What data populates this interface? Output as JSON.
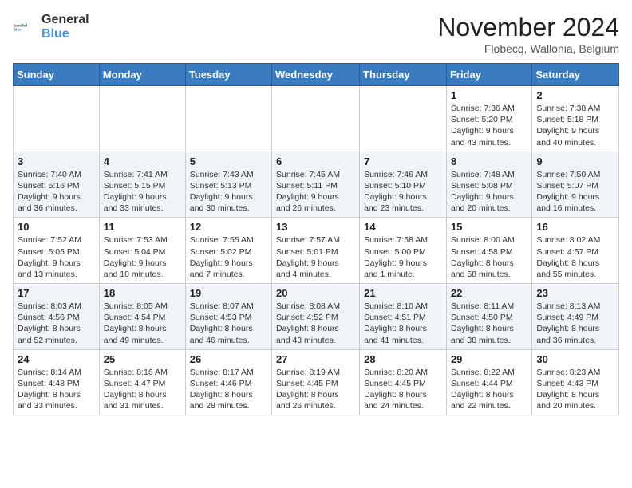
{
  "header": {
    "logo_line1": "General",
    "logo_line2": "Blue",
    "month_title": "November 2024",
    "location": "Flobecq, Wallonia, Belgium"
  },
  "columns": [
    "Sunday",
    "Monday",
    "Tuesday",
    "Wednesday",
    "Thursday",
    "Friday",
    "Saturday"
  ],
  "weeks": [
    [
      {
        "day": "",
        "info": ""
      },
      {
        "day": "",
        "info": ""
      },
      {
        "day": "",
        "info": ""
      },
      {
        "day": "",
        "info": ""
      },
      {
        "day": "",
        "info": ""
      },
      {
        "day": "1",
        "info": "Sunrise: 7:36 AM\nSunset: 5:20 PM\nDaylight: 9 hours and 43 minutes."
      },
      {
        "day": "2",
        "info": "Sunrise: 7:38 AM\nSunset: 5:18 PM\nDaylight: 9 hours and 40 minutes."
      }
    ],
    [
      {
        "day": "3",
        "info": "Sunrise: 7:40 AM\nSunset: 5:16 PM\nDaylight: 9 hours and 36 minutes."
      },
      {
        "day": "4",
        "info": "Sunrise: 7:41 AM\nSunset: 5:15 PM\nDaylight: 9 hours and 33 minutes."
      },
      {
        "day": "5",
        "info": "Sunrise: 7:43 AM\nSunset: 5:13 PM\nDaylight: 9 hours and 30 minutes."
      },
      {
        "day": "6",
        "info": "Sunrise: 7:45 AM\nSunset: 5:11 PM\nDaylight: 9 hours and 26 minutes."
      },
      {
        "day": "7",
        "info": "Sunrise: 7:46 AM\nSunset: 5:10 PM\nDaylight: 9 hours and 23 minutes."
      },
      {
        "day": "8",
        "info": "Sunrise: 7:48 AM\nSunset: 5:08 PM\nDaylight: 9 hours and 20 minutes."
      },
      {
        "day": "9",
        "info": "Sunrise: 7:50 AM\nSunset: 5:07 PM\nDaylight: 9 hours and 16 minutes."
      }
    ],
    [
      {
        "day": "10",
        "info": "Sunrise: 7:52 AM\nSunset: 5:05 PM\nDaylight: 9 hours and 13 minutes."
      },
      {
        "day": "11",
        "info": "Sunrise: 7:53 AM\nSunset: 5:04 PM\nDaylight: 9 hours and 10 minutes."
      },
      {
        "day": "12",
        "info": "Sunrise: 7:55 AM\nSunset: 5:02 PM\nDaylight: 9 hours and 7 minutes."
      },
      {
        "day": "13",
        "info": "Sunrise: 7:57 AM\nSunset: 5:01 PM\nDaylight: 9 hours and 4 minutes."
      },
      {
        "day": "14",
        "info": "Sunrise: 7:58 AM\nSunset: 5:00 PM\nDaylight: 9 hours and 1 minute."
      },
      {
        "day": "15",
        "info": "Sunrise: 8:00 AM\nSunset: 4:58 PM\nDaylight: 8 hours and 58 minutes."
      },
      {
        "day": "16",
        "info": "Sunrise: 8:02 AM\nSunset: 4:57 PM\nDaylight: 8 hours and 55 minutes."
      }
    ],
    [
      {
        "day": "17",
        "info": "Sunrise: 8:03 AM\nSunset: 4:56 PM\nDaylight: 8 hours and 52 minutes."
      },
      {
        "day": "18",
        "info": "Sunrise: 8:05 AM\nSunset: 4:54 PM\nDaylight: 8 hours and 49 minutes."
      },
      {
        "day": "19",
        "info": "Sunrise: 8:07 AM\nSunset: 4:53 PM\nDaylight: 8 hours and 46 minutes."
      },
      {
        "day": "20",
        "info": "Sunrise: 8:08 AM\nSunset: 4:52 PM\nDaylight: 8 hours and 43 minutes."
      },
      {
        "day": "21",
        "info": "Sunrise: 8:10 AM\nSunset: 4:51 PM\nDaylight: 8 hours and 41 minutes."
      },
      {
        "day": "22",
        "info": "Sunrise: 8:11 AM\nSunset: 4:50 PM\nDaylight: 8 hours and 38 minutes."
      },
      {
        "day": "23",
        "info": "Sunrise: 8:13 AM\nSunset: 4:49 PM\nDaylight: 8 hours and 36 minutes."
      }
    ],
    [
      {
        "day": "24",
        "info": "Sunrise: 8:14 AM\nSunset: 4:48 PM\nDaylight: 8 hours and 33 minutes."
      },
      {
        "day": "25",
        "info": "Sunrise: 8:16 AM\nSunset: 4:47 PM\nDaylight: 8 hours and 31 minutes."
      },
      {
        "day": "26",
        "info": "Sunrise: 8:17 AM\nSunset: 4:46 PM\nDaylight: 8 hours and 28 minutes."
      },
      {
        "day": "27",
        "info": "Sunrise: 8:19 AM\nSunset: 4:45 PM\nDaylight: 8 hours and 26 minutes."
      },
      {
        "day": "28",
        "info": "Sunrise: 8:20 AM\nSunset: 4:45 PM\nDaylight: 8 hours and 24 minutes."
      },
      {
        "day": "29",
        "info": "Sunrise: 8:22 AM\nSunset: 4:44 PM\nDaylight: 8 hours and 22 minutes."
      },
      {
        "day": "30",
        "info": "Sunrise: 8:23 AM\nSunset: 4:43 PM\nDaylight: 8 hours and 20 minutes."
      }
    ]
  ]
}
